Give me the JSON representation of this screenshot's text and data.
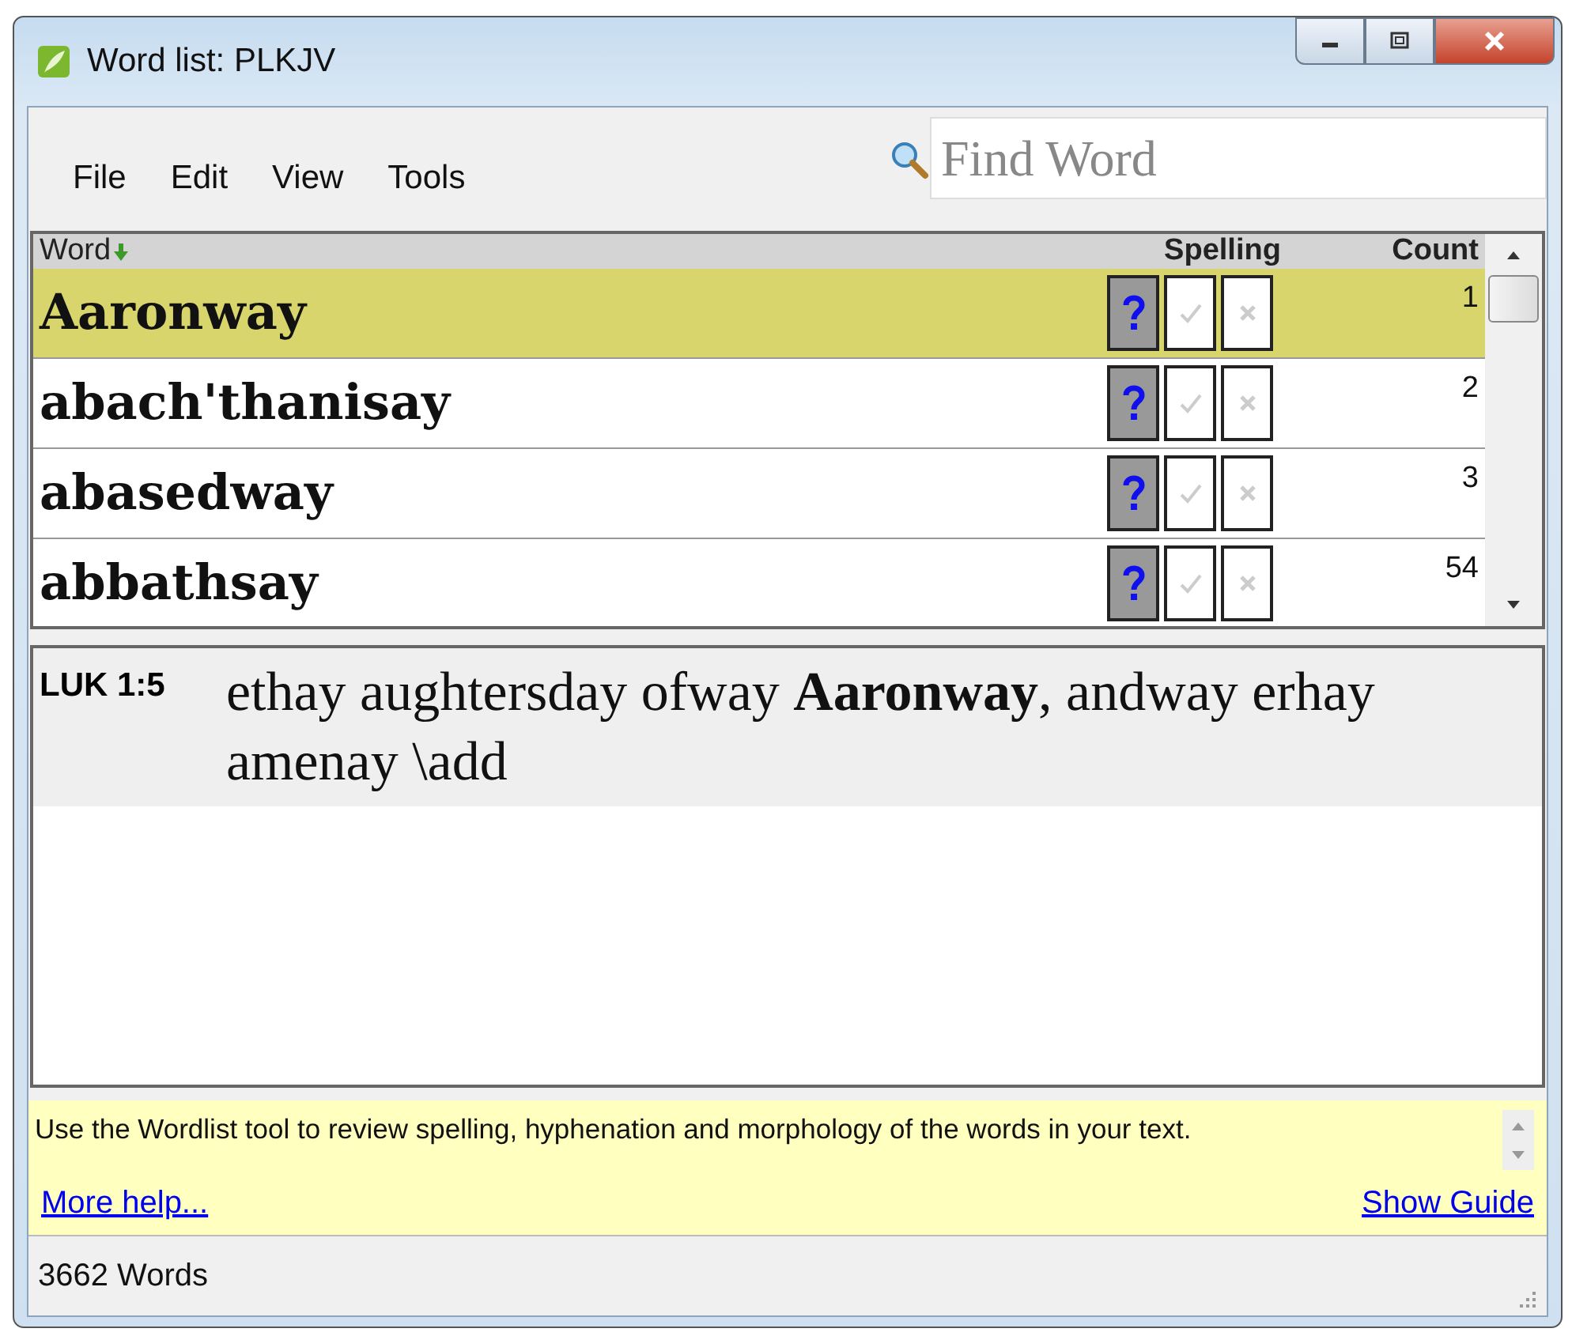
{
  "window": {
    "title": "Word list: PLKJV"
  },
  "menu": [
    "File",
    "Edit",
    "View",
    "Tools"
  ],
  "search": {
    "placeholder": "Find Word"
  },
  "table": {
    "columns": [
      "Word",
      "Spelling",
      "Count"
    ],
    "rows": [
      {
        "word": "Aaronway",
        "unknown": true,
        "correct": false,
        "incorrect": false,
        "count": "1",
        "selected": true
      },
      {
        "word": "abach'thanisay",
        "unknown": true,
        "correct": false,
        "incorrect": false,
        "count": "2",
        "selected": false
      },
      {
        "word": "abasedway",
        "unknown": true,
        "correct": false,
        "incorrect": false,
        "count": "3",
        "selected": false
      },
      {
        "word": "abbathsay",
        "unknown": true,
        "correct": false,
        "incorrect": false,
        "count": "54",
        "selected": false
      }
    ]
  },
  "context": [
    {
      "reference": "LUK 1:5",
      "text": "ethay aughtersday ofway **Aaronway**, andway erhay amenay \\add",
      "selected": true
    }
  ],
  "help": {
    "text": "Use the Wordlist tool to review spelling, hyphenation and morphology of the words in your text.",
    "more_link": "More help...",
    "guide_link": "Show Guide"
  },
  "status_bar": "3662 Words"
}
